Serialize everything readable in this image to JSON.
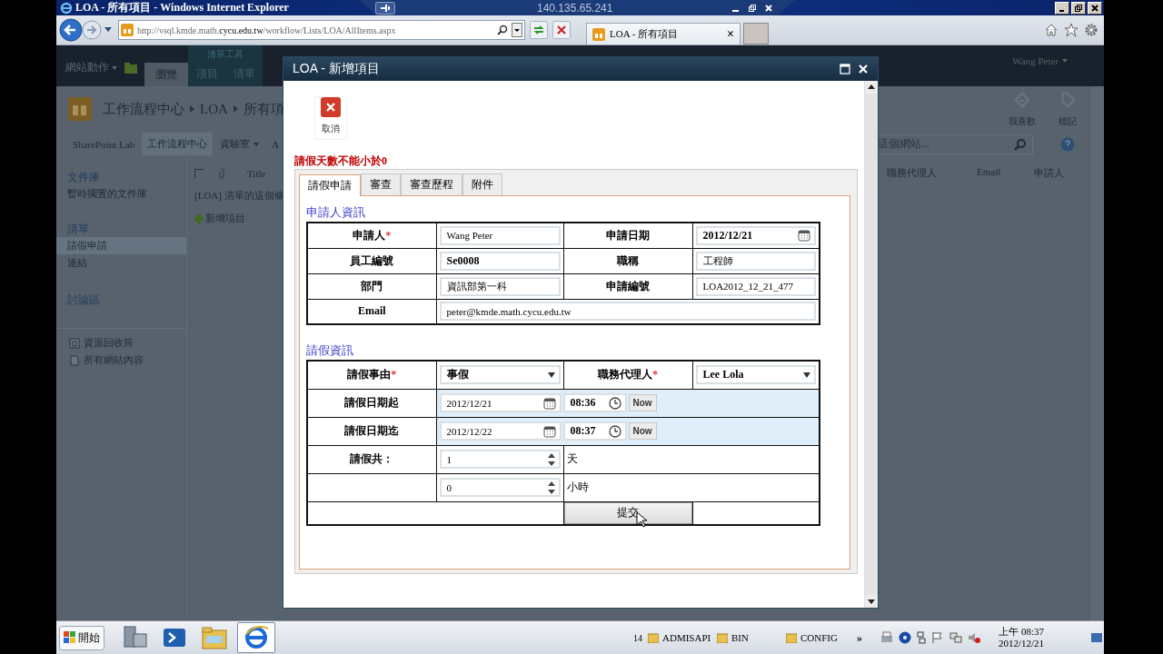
{
  "browser": {
    "title": "LOA - 所有項目 - Windows Internet Explorer",
    "address": "http://vsql.kmde.math.**cycu.edu.tw**/workflow/Lists/LOA/AllItems.aspx",
    "tab_title": "LOA - 所有項目",
    "tab_close": "×"
  },
  "remote_bar": {
    "host": "140.135.65.241"
  },
  "ribbon": {
    "site_actions": "網站動作",
    "tool_group": "清單工具",
    "tabs": [
      {
        "label": "瀏覽",
        "selected": true
      },
      {
        "label": "項目",
        "selected": false
      },
      {
        "label": "清單",
        "selected": false
      }
    ],
    "user": "Wang Peter"
  },
  "site": {
    "breadcrumb": [
      "工作流程中心",
      "LOA",
      "所有項"
    ],
    "actions": [
      "我喜歡",
      "標記"
    ],
    "top_nav": [
      {
        "label": "SharePoint Lab",
        "selected": false,
        "dropdown": false
      },
      {
        "label": "工作流程中心",
        "selected": true,
        "dropdown": false
      },
      {
        "label": "資驗室",
        "selected": false,
        "dropdown": true
      },
      {
        "label": "A",
        "selected": false,
        "dropdown": false
      }
    ],
    "search_placeholder": "這個網站..."
  },
  "quick_launch": [
    {
      "kind": "heading",
      "label": "文件庫",
      "selected": false
    },
    {
      "kind": "link",
      "label": "暫時擱置的文件庫",
      "selected": false
    },
    {
      "kind": "heading",
      "label": "清單",
      "selected": false
    },
    {
      "kind": "link",
      "label": "請假申請",
      "selected": true
    },
    {
      "kind": "link",
      "label": "連結",
      "selected": false
    },
    {
      "kind": "heading",
      "label": "討論區",
      "selected": false
    }
  ],
  "quick_launch_footer": [
    {
      "kind": "recycle",
      "label": "資源回收筒"
    },
    {
      "kind": "pages",
      "label": "所有網站內容"
    }
  ],
  "list": {
    "select_all_checked": false,
    "title_column": "Title",
    "description": "[LOA] 清單的這個條",
    "new_item": "新增項目",
    "right_columns": [
      "職務代理人",
      "Email",
      "申請人"
    ]
  },
  "dialog": {
    "title": "LOA - 新增項目",
    "cancel": "取消",
    "error": "請假天數不能小於0",
    "tabs": [
      {
        "label": "請假申請",
        "selected": true
      },
      {
        "label": "審查",
        "selected": false
      },
      {
        "label": "審查歷程",
        "selected": false
      },
      {
        "label": "附件",
        "selected": false
      }
    ],
    "applicant": {
      "heading": "申請人資訊",
      "rows": [
        {
          "cells": [
            {
              "kind": "label",
              "text": "申請人",
              "required": "*"
            },
            {
              "kind": "text",
              "value": "Wang Peter",
              "bold": false
            },
            {
              "kind": "label",
              "text": "申請日期"
            },
            {
              "kind": "date",
              "value": "2012/12/21",
              "bold": true
            }
          ]
        },
        {
          "cells": [
            {
              "kind": "label",
              "text": "員工編號"
            },
            {
              "kind": "text",
              "value": "Se0008",
              "bold": true
            },
            {
              "kind": "label",
              "text": "職稱"
            },
            {
              "kind": "text",
              "value": "工程師",
              "bold": false
            }
          ]
        },
        {
          "cells": [
            {
              "kind": "label",
              "text": "部門"
            },
            {
              "kind": "text",
              "value": "資訊部第一科",
              "bold": false
            },
            {
              "kind": "label",
              "text": "申請編號"
            },
            {
              "kind": "text",
              "value": "LOA2012_12_21_477",
              "bold": false
            }
          ]
        },
        {
          "cells": [
            {
              "kind": "label",
              "text": "Email"
            },
            {
              "kind": "text",
              "value": "peter@kmde.math.cycu.edu.tw",
              "bold": false,
              "colspan": 3
            }
          ]
        }
      ]
    },
    "leave": {
      "heading": "請假資訊",
      "rows": [
        {
          "cells": [
            {
              "kind": "label",
              "text": "請假事由",
              "required": "*"
            },
            {
              "kind": "select",
              "value": "事假"
            },
            {
              "kind": "label",
              "text": "職務代理人",
              "required": "*"
            },
            {
              "kind": "select",
              "value": "Lee Lola"
            }
          ]
        },
        {
          "cells": [
            {
              "kind": "label",
              "text": "請假日期起"
            },
            {
              "kind": "datetime",
              "date": "2012/12/21",
              "time": "08:36",
              "button": "Now",
              "highlight": true,
              "colspan": 3
            }
          ]
        },
        {
          "cells": [
            {
              "kind": "label",
              "text": "請假日期迄"
            },
            {
              "kind": "datetime",
              "date": "2012/12/22",
              "time": "08:37",
              "button": "Now",
              "highlight": true,
              "colspan": 3
            }
          ]
        },
        {
          "cells": [
            {
              "kind": "label",
              "text": "請假共："
            },
            {
              "kind": "number",
              "value": "1"
            },
            {
              "kind": "unit",
              "text": "天",
              "colspan": 2
            }
          ]
        },
        {
          "cells": [
            {
              "kind": "empty"
            },
            {
              "kind": "number",
              "value": "0"
            },
            {
              "kind": "unit",
              "text": "小時",
              "colspan": 2
            }
          ]
        },
        {
          "cells": [
            {
              "kind": "empty",
              "colspan": 2
            },
            {
              "kind": "submit",
              "text": "提交"
            },
            {
              "kind": "empty"
            }
          ]
        }
      ]
    }
  },
  "taskbar": {
    "start": "開始",
    "toolbar_count": "14",
    "folders": [
      "ADMISAPI",
      "BIN",
      "CONFIG"
    ],
    "more": "»",
    "time": "上午 08:37",
    "date": "2012/12/21"
  }
}
